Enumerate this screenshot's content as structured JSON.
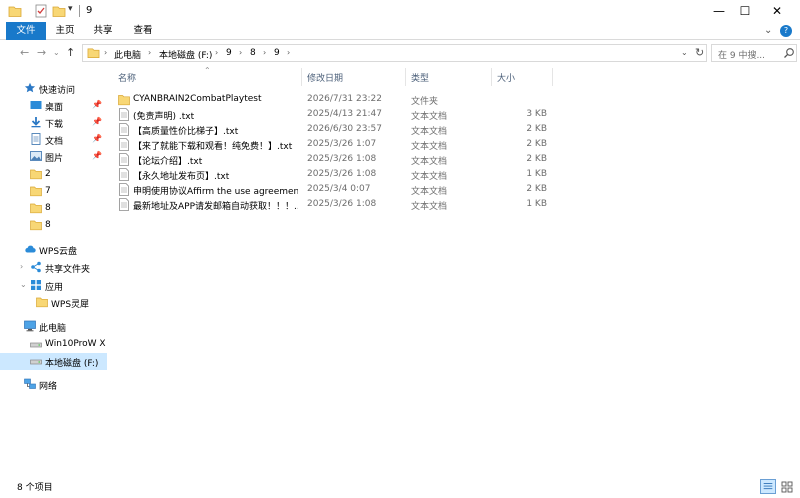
{
  "window": {
    "title": "9",
    "controls": {
      "minimize": "—",
      "maximize": "☐",
      "close": "✕"
    }
  },
  "ribbon": {
    "tabs": [
      {
        "label": "文件"
      },
      {
        "label": "主页"
      },
      {
        "label": "共享"
      },
      {
        "label": "查看"
      }
    ],
    "help_label": "?"
  },
  "address_bar": {
    "breadcrumbs": [
      "此电脑",
      "本地磁盘 (F:)",
      "9",
      "8",
      "9"
    ]
  },
  "search": {
    "placeholder": "在 9 中搜..."
  },
  "nav_pane": {
    "quick_access": "快速访问",
    "pinned": [
      {
        "label": "桌面",
        "icon": "desktop-icon"
      },
      {
        "label": "下载",
        "icon": "download-icon"
      },
      {
        "label": "文档",
        "icon": "document-icon"
      },
      {
        "label": "图片",
        "icon": "picture-icon"
      }
    ],
    "folders": [
      "2",
      "7",
      "8",
      "8"
    ],
    "wps_cloud": "WPS云盘",
    "shared_folder": "共享文件夹",
    "apps": "应用",
    "wps_lingxi": "WPS灵犀",
    "this_pc": "此电脑",
    "drives": [
      "Win10ProW X",
      "本地磁盘 (F:)"
    ],
    "network": "网络"
  },
  "file_list": {
    "columns": [
      "名称",
      "修改日期",
      "类型",
      "大小"
    ],
    "rows": [
      {
        "name": "CYANBRAIN2CombatPlaytest",
        "date": "2026/7/31 23:22",
        "type": "文件夹",
        "size": "",
        "kind": "folder"
      },
      {
        "name": "(免责声明) .txt",
        "date": "2025/4/13 21:47",
        "type": "文本文档",
        "size": "3 KB",
        "kind": "txt"
      },
      {
        "name": "【高质量性价比梯子】.txt",
        "date": "2026/6/30 23:57",
        "type": "文本文档",
        "size": "2 KB",
        "kind": "txt"
      },
      {
        "name": "【来了就能下载和观看！纯免费！】.txt",
        "date": "2025/3/26 1:07",
        "type": "文本文档",
        "size": "2 KB",
        "kind": "txt"
      },
      {
        "name": "【论坛介绍】.txt",
        "date": "2025/3/26 1:08",
        "type": "文本文档",
        "size": "2 KB",
        "kind": "txt"
      },
      {
        "name": "【永久地址发布页】.txt",
        "date": "2025/3/26 1:08",
        "type": "文本文档",
        "size": "1 KB",
        "kind": "txt"
      },
      {
        "name": "申明使用协议Affirm the use agreemen...",
        "date": "2025/3/4 0:07",
        "type": "文本文档",
        "size": "2 KB",
        "kind": "txt"
      },
      {
        "name": "最新地址及APP请发邮箱自动获取！！！....",
        "date": "2025/3/26 1:08",
        "type": "文本文档",
        "size": "1 KB",
        "kind": "txt"
      }
    ]
  },
  "status_bar": {
    "item_count": "8 个项目"
  },
  "colors": {
    "accent": "#1979ca",
    "selection": "#cce8ff",
    "folder": "#f8d775",
    "header_text": "#4c607a"
  }
}
